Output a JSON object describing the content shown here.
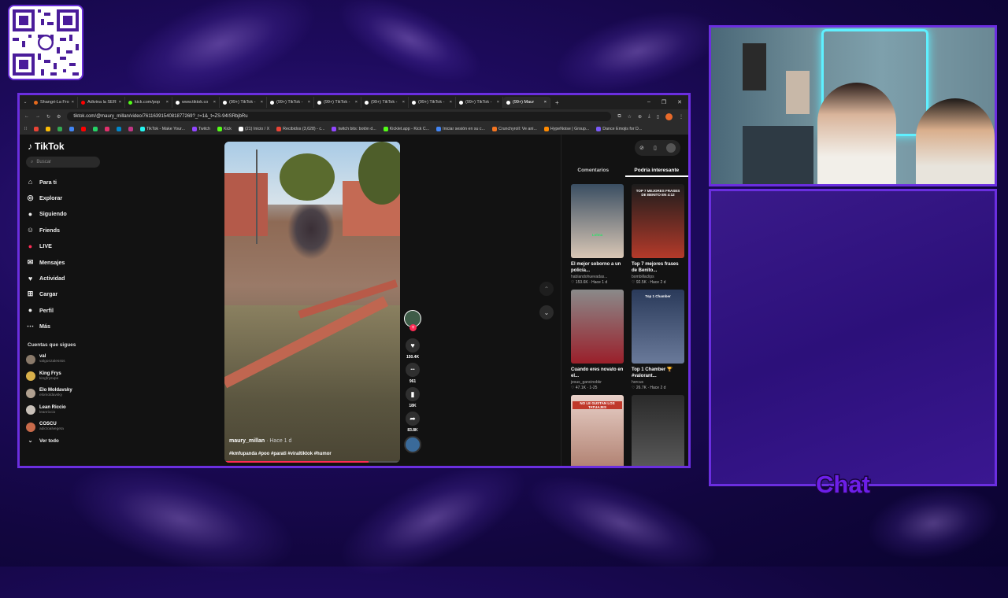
{
  "browser": {
    "tabs": [
      {
        "label": "Shangri-La Fro",
        "color": "#e66a1d",
        "active": false
      },
      {
        "label": "Adivina la SER",
        "color": "#ff0000",
        "active": false
      },
      {
        "label": "kick.com/pop",
        "color": "#53fc18",
        "active": false
      },
      {
        "label": "www.tiktok.co",
        "color": "#ffffff",
        "active": false
      },
      {
        "label": "(99+) TikTok -",
        "color": "#ffffff",
        "active": false
      },
      {
        "label": "(99+) TikTok -",
        "color": "#ffffff",
        "active": false
      },
      {
        "label": "(99+) TikTok -",
        "color": "#ffffff",
        "active": false
      },
      {
        "label": "(99+) TikTok -",
        "color": "#ffffff",
        "active": false
      },
      {
        "label": "(99+) TikTok -",
        "color": "#ffffff",
        "active": false
      },
      {
        "label": "(99+) TikTok -",
        "color": "#ffffff",
        "active": false
      },
      {
        "label": "(99+) Maur",
        "color": "#ffffff",
        "active": true
      }
    ],
    "new_tab": "+",
    "controls": {
      "minimize": "–",
      "maximize": "❐",
      "close": "✕"
    },
    "url": "tiktok.com/@maury_millan/video/7611639154081877269?_r=1&_t=ZS-94ISRbjbRu",
    "bookmarks": [
      "TikTok - Make Your...",
      "Twitch",
      "Kick",
      "(21) Inicio / X",
      "Recibidos (3,628) - c...",
      "twitch bits: botón d...",
      "Kicklet.app - Kick C...",
      "Iniciar sesión en su c...",
      "Crunchyroll: Ve ani...",
      "HypeNoise | Group...",
      "Dance Emojis for D..."
    ]
  },
  "tiktok": {
    "logo": "TikTok",
    "search_placeholder": "Buscar",
    "nav": [
      {
        "label": "Para ti",
        "icon": "home-icon",
        "glyph": "⌂"
      },
      {
        "label": "Explorar",
        "icon": "compass-icon",
        "glyph": "◎"
      },
      {
        "label": "Siguiendo",
        "icon": "following-icon",
        "glyph": "●"
      },
      {
        "label": "Friends",
        "icon": "friends-icon",
        "glyph": "☺"
      },
      {
        "label": "LIVE",
        "icon": "live-icon",
        "glyph": "●"
      },
      {
        "label": "Mensajes",
        "icon": "messages-icon",
        "glyph": "✉"
      },
      {
        "label": "Actividad",
        "icon": "activity-icon",
        "glyph": "♥"
      },
      {
        "label": "Cargar",
        "icon": "upload-icon",
        "glyph": "⊞"
      },
      {
        "label": "Perfil",
        "icon": "profile-icon",
        "glyph": "●"
      },
      {
        "label": "Más",
        "icon": "more-icon",
        "glyph": "⋯"
      }
    ],
    "following_title": "Cuentas que sigues",
    "accounts": [
      {
        "name": "val",
        "handle": "valgonzalessss",
        "color": "#8a7a6a"
      },
      {
        "name": "King Frys",
        "handle": "kingfrysvpe",
        "color": "#d8b04a"
      },
      {
        "name": "Elo Moldavsky",
        "handle": "elomoldavsky",
        "color": "#b0a090"
      },
      {
        "name": "Lean Riccio",
        "handle": "leanriccio",
        "color": "#c8c0b8"
      },
      {
        "name": "COSCU",
        "handle": "adictoalvegeta",
        "color": "#c86a4a"
      }
    ],
    "see_all": "Ver todo",
    "video": {
      "username": "maury_millan",
      "time": "· Hace 1 d",
      "tags": "#kmfupanda #poo #parati #viraltiktok #humor",
      "progress": 0.82
    },
    "actions": [
      {
        "icon": "heart-icon",
        "glyph": "♥",
        "count": "150.4K"
      },
      {
        "icon": "comment-icon",
        "glyph": "•••",
        "count": "961"
      },
      {
        "icon": "bookmark-icon",
        "glyph": "▮",
        "count": "18K"
      },
      {
        "icon": "share-icon",
        "glyph": "➦",
        "count": "83.8K"
      }
    ],
    "right_tabs": {
      "comments": "Comentarios",
      "interesting": "Podría interesante"
    },
    "cards": [
      {
        "title": "El mejor soborno a un policía...",
        "author": "hablandohuevadas...",
        "meta": "♡ 153.6K · Hace 1 d",
        "thumb_text": "Lolma",
        "c1": "#3a4e62",
        "c2": "#d9c7b5"
      },
      {
        "title": "Top 7 mejores frases de Benito...",
        "author": "bombillaclips",
        "meta": "♡ 92.5K · Hace 2 d",
        "thumb_text": "TOP 7 MEJORES FRASES DE BENITO EN 4:12",
        "c1": "#1c1c1c",
        "c2": "#b43a2a"
      },
      {
        "title": "Cuando eres novato en el...",
        "author": "jesus_gancinobkr",
        "meta": "♡ 47.1K · 1-25",
        "thumb_text": "",
        "c1": "#8a8a8a",
        "c2": "#9a1f2a"
      },
      {
        "title": "Top 1 Chamber 🏆 #valorant...",
        "author": "horcus",
        "meta": "♡ 26.7K · Hace 2 d",
        "thumb_text": "Top 1 Chamber",
        "c1": "#2a3a5a",
        "c2": "#6a7a9a"
      },
      {
        "title": "",
        "author": "",
        "meta": "",
        "thumb_text": "NO LE GUSTAN LOS TATUAJES",
        "c1": "#e8d0c8",
        "c2": "#b08070"
      },
      {
        "title": "",
        "author": "",
        "meta": "",
        "thumb_text": "",
        "c1": "#2a2a2a",
        "c2": "#5a5a5a"
      }
    ]
  },
  "overlay": {
    "chat_label": "Chat"
  },
  "colors": {
    "accent": "#6b2ee0",
    "tiktok_red": "#fe2c55",
    "tiktok_cyan": "#20d5ec"
  }
}
